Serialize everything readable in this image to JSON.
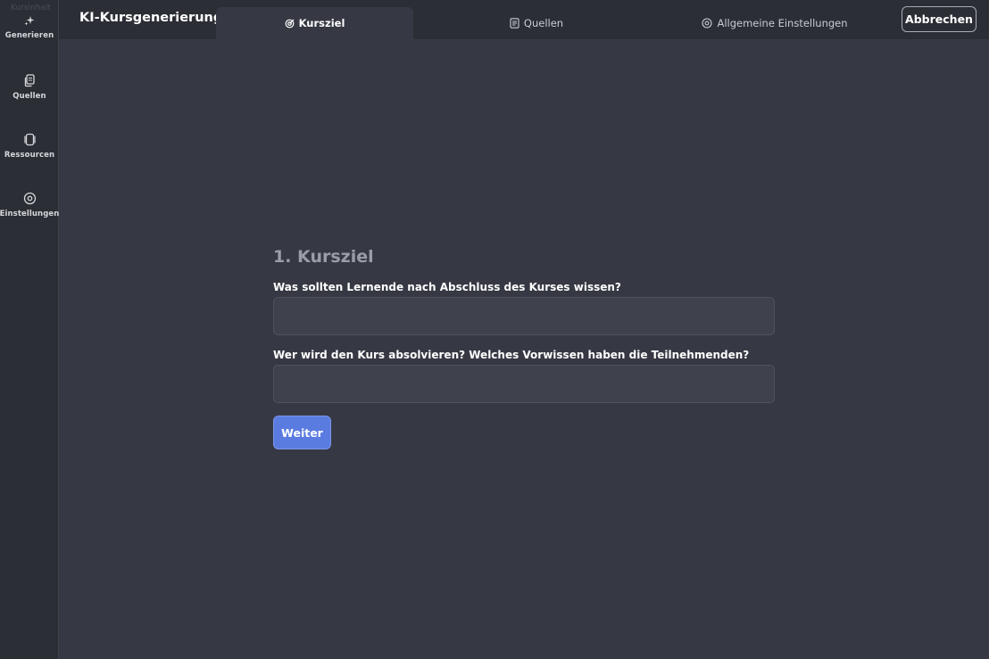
{
  "sidebar": {
    "ghost_text": "Kursinhalt",
    "items": [
      {
        "label": "Generieren",
        "icon": "sparkle-icon"
      },
      {
        "label": "Quellen",
        "icon": "documents-icon"
      },
      {
        "label": "Ressourcen",
        "icon": "resources-icon"
      },
      {
        "label": "Einstellungen",
        "icon": "gear-icon"
      }
    ]
  },
  "header": {
    "title": "KI-Kursgenerierung",
    "tabs": [
      {
        "label": "Kursziel",
        "icon": "target-icon",
        "active": true
      },
      {
        "label": "Quellen",
        "icon": "document-icon",
        "active": false
      },
      {
        "label": "Allgemeine Einstellungen",
        "icon": "settings-circle-icon",
        "active": false
      }
    ],
    "cancel_label": "Abbrechen"
  },
  "form": {
    "title": "1. Kursziel",
    "fields": [
      {
        "label": "Was sollten Lernende nach Abschluss des Kurses wissen?",
        "value": "",
        "placeholder": ""
      },
      {
        "label": "Wer wird den Kurs absolvieren? Welches Vorwissen haben die Teilnehmenden?",
        "value": "",
        "placeholder": ""
      }
    ],
    "next_label": "Weiter"
  },
  "colors": {
    "background": "#363943",
    "sidebar": "#2c2e36",
    "input": "#3f424c",
    "accent": "#5a7be0"
  }
}
